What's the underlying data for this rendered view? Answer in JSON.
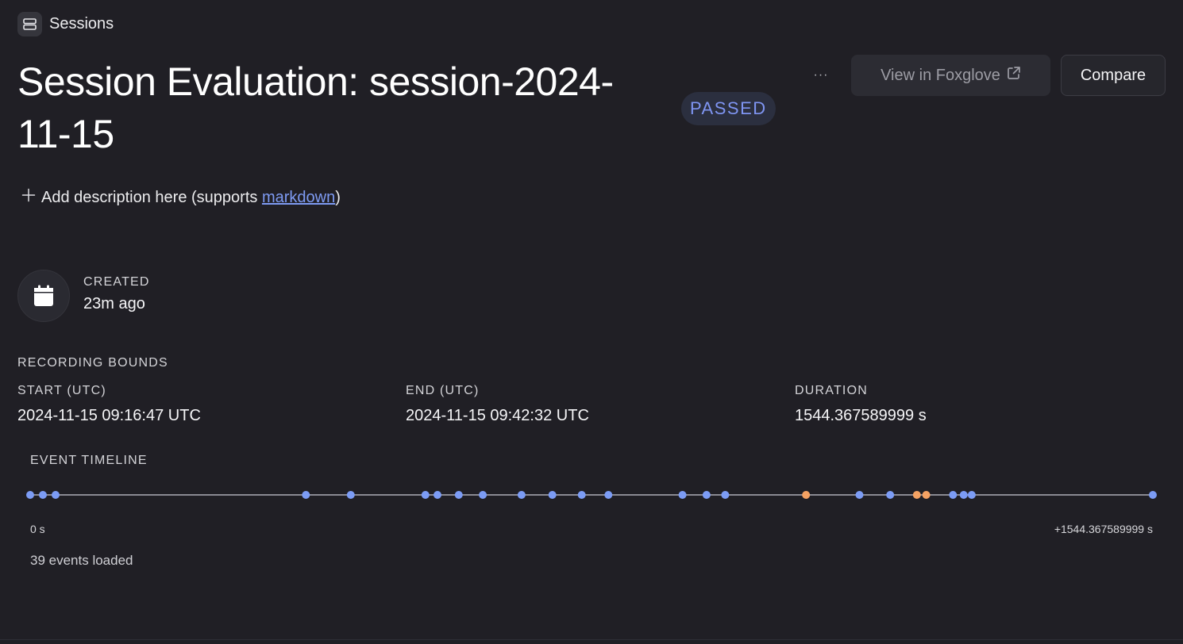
{
  "breadcrumb": {
    "label": "Sessions",
    "icon": "server-stack-icon"
  },
  "header": {
    "title": "Session Evaluation: session-2024-11-15",
    "status_badge": "PASSED",
    "more_label": "···",
    "view_in_foxglove_label": "View in Foxglove",
    "compare_label": "Compare"
  },
  "description": {
    "prefix": "Add description here (supports ",
    "link_text": "markdown",
    "suffix": ")"
  },
  "created": {
    "label": "CREATED",
    "value": "23m ago",
    "icon": "calendar-icon"
  },
  "recording_bounds": {
    "heading": "RECORDING BOUNDS",
    "start_label": "START (UTC)",
    "start_value": "2024-11-15 09:16:47 UTC",
    "end_label": "END (UTC)",
    "end_value": "2024-11-15 09:42:32 UTC",
    "duration_label": "DURATION",
    "duration_value": "1544.367589999 s"
  },
  "timeline": {
    "heading": "EVENT TIMELINE",
    "start_tick": "0 s",
    "end_tick": "+1544.367589999 s",
    "duration_s": 1544.367589999,
    "events_loaded": "39 events loaded",
    "colors": {
      "default": "#7c9cf5",
      "warning": "#f5a263",
      "track": "#8a8a92"
    },
    "events": [
      {
        "t": 0.0,
        "kind": "default"
      },
      {
        "t": 17.5,
        "kind": "default"
      },
      {
        "t": 34.9,
        "kind": "default"
      },
      {
        "t": 379.3,
        "kind": "default"
      },
      {
        "t": 441.0,
        "kind": "default"
      },
      {
        "t": 543.7,
        "kind": "default"
      },
      {
        "t": 560.3,
        "kind": "default"
      },
      {
        "t": 589.6,
        "kind": "default"
      },
      {
        "t": 622.7,
        "kind": "default"
      },
      {
        "t": 676.0,
        "kind": "default"
      },
      {
        "t": 718.3,
        "kind": "default"
      },
      {
        "t": 758.7,
        "kind": "default"
      },
      {
        "t": 795.4,
        "kind": "default"
      },
      {
        "t": 897.3,
        "kind": "default"
      },
      {
        "t": 930.4,
        "kind": "default"
      },
      {
        "t": 956.1,
        "kind": "default"
      },
      {
        "t": 1067.3,
        "kind": "warning"
      },
      {
        "t": 1140.8,
        "kind": "default"
      },
      {
        "t": 1183.1,
        "kind": "default"
      },
      {
        "t": 1219.8,
        "kind": "warning"
      },
      {
        "t": 1232.7,
        "kind": "warning"
      },
      {
        "t": 1269.5,
        "kind": "default"
      },
      {
        "t": 1284.2,
        "kind": "default"
      },
      {
        "t": 1295.2,
        "kind": "default"
      },
      {
        "t": 1544.37,
        "kind": "default"
      }
    ]
  }
}
